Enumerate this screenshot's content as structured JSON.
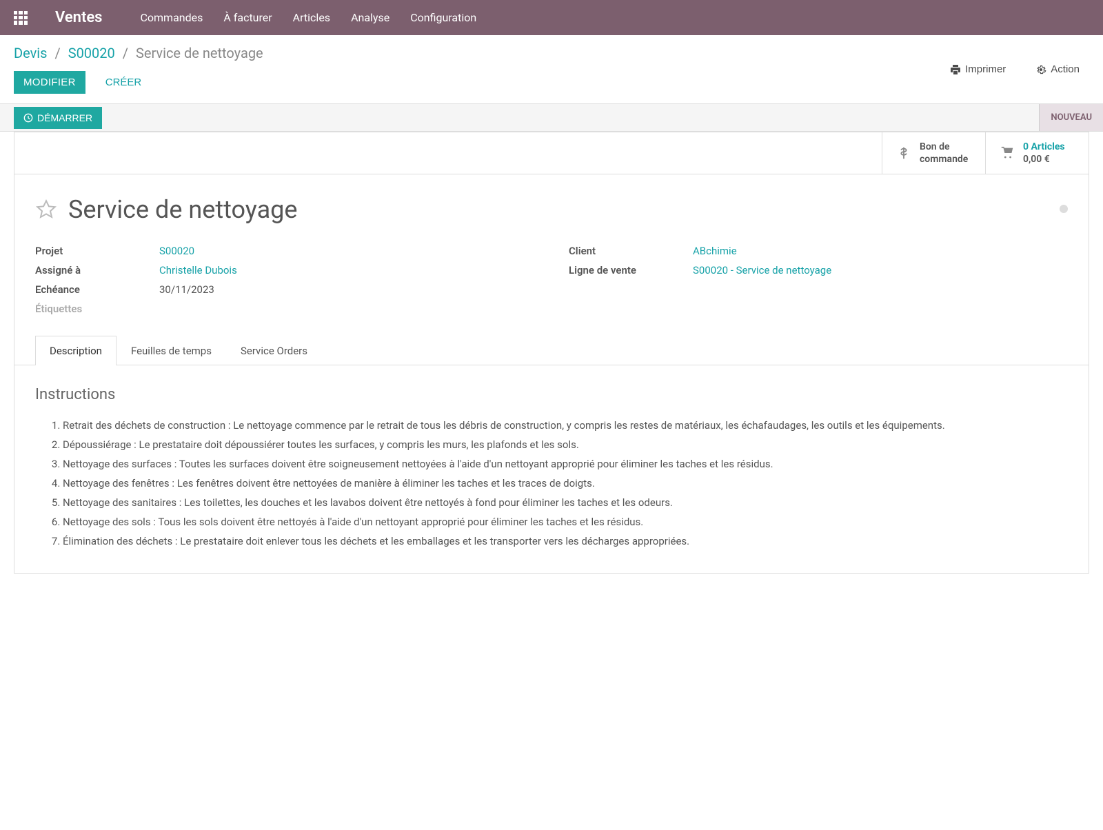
{
  "app": {
    "name": "Ventes"
  },
  "nav": {
    "items": [
      "Commandes",
      "À facturer",
      "Articles",
      "Analyse",
      "Configuration"
    ]
  },
  "breadcrumb": {
    "items": [
      "Devis",
      "S00020"
    ],
    "current": "Service de nettoyage"
  },
  "buttons": {
    "modify": "MODIFIER",
    "create": "CRÉER",
    "print": "Imprimer",
    "action": "Action",
    "start": "DÉMARRER"
  },
  "status": {
    "current": "NOUVEAU"
  },
  "stats": {
    "purchase": {
      "title": "Bon de",
      "subtitle": "commande"
    },
    "articles": {
      "title": "0 Articles",
      "subtitle": "0,00 €"
    }
  },
  "record": {
    "title": "Service de nettoyage",
    "fields": {
      "project_label": "Projet",
      "project_value": "S00020",
      "assigned_label": "Assigné à",
      "assigned_value": "Christelle Dubois",
      "deadline_label": "Echéance",
      "deadline_value": "30/11/2023",
      "tags_label": "Étiquettes",
      "client_label": "Client",
      "client_value": "ABchimie",
      "saleline_label": "Ligne de vente",
      "saleline_value": "S00020 - Service de nettoyage"
    }
  },
  "tabs": {
    "items": [
      "Description",
      "Feuilles de temps",
      "Service Orders"
    ]
  },
  "description": {
    "heading": "Instructions",
    "items": [
      "Retrait des déchets de construction : Le nettoyage commence par le retrait de tous les débris de construction, y compris les restes de matériaux, les échafaudages, les outils et les équipements.",
      "Dépoussiérage : Le prestataire doit dépoussiérer toutes les surfaces, y compris les murs, les plafonds et les sols.",
      "Nettoyage des surfaces : Toutes les surfaces doivent être soigneusement nettoyées à l'aide d'un nettoyant approprié pour éliminer les taches et les résidus.",
      "Nettoyage des fenêtres : Les fenêtres doivent être nettoyées de manière à éliminer les taches et les traces de doigts.",
      "Nettoyage des sanitaires : Les toilettes, les douches et les lavabos doivent être nettoyés à fond pour éliminer les taches et les odeurs.",
      "Nettoyage des sols : Tous les sols doivent être nettoyés à l'aide d'un nettoyant approprié pour éliminer les taches et les résidus.",
      "Élimination des déchets : Le prestataire doit enlever tous les déchets et les emballages et les transporter vers les décharges appropriées."
    ]
  }
}
